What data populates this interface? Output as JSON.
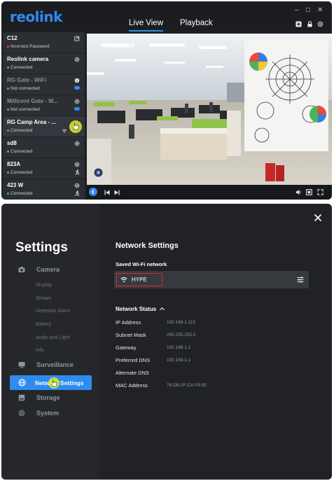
{
  "app": {
    "logo": "reolink",
    "tabs": [
      "Live View",
      "Playback"
    ],
    "window_controls": [
      "–",
      "□",
      "✕"
    ]
  },
  "devices": [
    {
      "name": "C12",
      "status": "Incorrect Password",
      "status_color": "#e04848",
      "icon": "edit-icon"
    },
    {
      "name": "Reolink camera",
      "status": "Connected",
      "status_color": "#3cc36a",
      "icon": "gear-icon"
    },
    {
      "name": "RG Gate - WiFi",
      "status": "Not connected",
      "status_color": "#8a8f96",
      "icon": "info-icon"
    },
    {
      "name": "Millicent Gate - W...",
      "status": "Not connected",
      "status_color": "#8a8f96",
      "icon": "gear-icon"
    },
    {
      "name": "RG Camp Area - ...",
      "status": "Connected",
      "status_color": "#3cc36a",
      "icon": "wifi-icon"
    },
    {
      "name": "sd8",
      "status": "Connected",
      "status_color": "#3cc36a",
      "icon": "gear-icon"
    },
    {
      "name": "823A",
      "status": "Connected",
      "status_color": "#3cc36a",
      "icon": "gear-icon"
    },
    {
      "name": "423 W",
      "status": "Connected",
      "status_color": "#3cc36a",
      "icon": "gear-icon"
    }
  ],
  "video": {
    "watermark": "reolink"
  },
  "settings": {
    "title": "Settings",
    "nav": [
      {
        "label": "Camera",
        "icon": "camera-icon",
        "children": [
          "Display",
          "Stream",
          "Detection Alarm",
          "Battery",
          "Audio and Light",
          "Info"
        ]
      },
      {
        "label": "Surveillance",
        "icon": "monitor-icon",
        "children": []
      },
      {
        "label": "Network Settings",
        "icon": "globe-icon",
        "active": true,
        "children": []
      },
      {
        "label": "Storage",
        "icon": "storage-icon",
        "children": []
      },
      {
        "label": "System",
        "icon": "gear-icon",
        "children": []
      }
    ],
    "page_title": "Network Settings",
    "saved_wifi_label": "Saved Wi-Fi network",
    "wifi_name": "HYPE",
    "network_status_label": "Network Status",
    "status": [
      {
        "key": "IP Address",
        "value": "192.168.1.115"
      },
      {
        "key": "Subnet Mask",
        "value": "255.255.255.0"
      },
      {
        "key": "Gateway",
        "value": "192.168.1.1"
      },
      {
        "key": "Preferred DNS",
        "value": "192.168.1.1"
      },
      {
        "key": "Alternate DNS",
        "value": ""
      },
      {
        "key": "MAC Address",
        "value": "78:DB:2F:CA:F9:90"
      }
    ]
  },
  "colors": {
    "accent": "#2f8bf0",
    "highlight_border": "#e02b2b",
    "cursor": "#e1eb28"
  }
}
